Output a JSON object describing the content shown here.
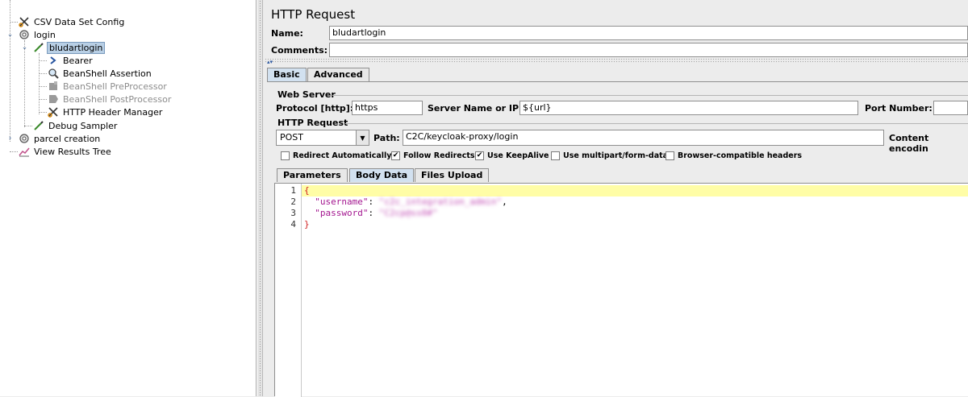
{
  "tree": {
    "items": [
      {
        "label": "CSV Data Set Config",
        "icon": "scissors-icon"
      },
      {
        "label": "login",
        "icon": "gear-icon"
      },
      {
        "label": "bludartlogin",
        "icon": "pipette-icon"
      },
      {
        "label": "Bearer",
        "icon": "arrow-icon"
      },
      {
        "label": "BeanShell Assertion",
        "icon": "magnifier-icon"
      },
      {
        "label": "BeanShell PreProcessor",
        "icon": "preprocessor-icon"
      },
      {
        "label": "BeanShell PostProcessor",
        "icon": "postprocessor-icon"
      },
      {
        "label": "HTTP Header Manager",
        "icon": "scissors-icon"
      },
      {
        "label": "Debug Sampler",
        "icon": "pipette-icon"
      },
      {
        "label": "parcel creation",
        "icon": "gear-icon"
      },
      {
        "label": "View Results Tree",
        "icon": "chart-icon"
      }
    ]
  },
  "panel": {
    "title": "HTTP Request",
    "name_label": "Name:",
    "name_value": "bludartlogin",
    "comments_label": "Comments:",
    "comments_value": "",
    "tabs": [
      {
        "label": "Basic"
      },
      {
        "label": "Advanced"
      }
    ],
    "web_server": {
      "title": "Web Server",
      "protocol_label": "Protocol [http]:",
      "protocol_value": "https",
      "server_label": "Server Name or IP:",
      "server_value": "${url}",
      "port_label": "Port Number:"
    },
    "http_request": {
      "title": "HTTP Request",
      "method": "POST",
      "path_label": "Path:",
      "path_value": "C2C/keycloak-proxy/login",
      "encoding_label": "Content encodin"
    },
    "options": [
      {
        "label": "Redirect Automatically",
        "checked": false
      },
      {
        "label": "Follow Redirects",
        "checked": true
      },
      {
        "label": "Use KeepAlive",
        "checked": true
      },
      {
        "label": "Use multipart/form-data",
        "checked": false
      },
      {
        "label": "Browser-compatible headers",
        "checked": false
      }
    ],
    "subtabs": [
      {
        "label": "Parameters"
      },
      {
        "label": "Body Data"
      },
      {
        "label": "Files Upload"
      }
    ],
    "editor": {
      "line_numbers": [
        "1",
        "2",
        "3",
        "4"
      ],
      "open_brace": "{",
      "username_key": "\"username\"",
      "username_value": "\"c2c_integration_admin\"",
      "password_key": "\"password\"",
      "password_value": "\"C2cp@ss0#\"",
      "close_brace": "}"
    }
  }
}
